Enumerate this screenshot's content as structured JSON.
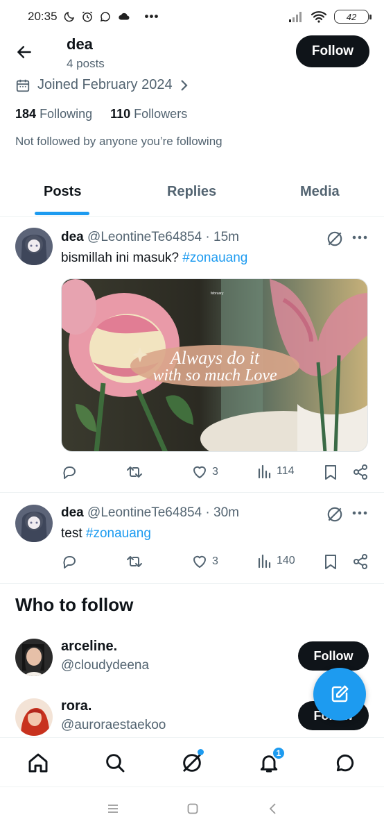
{
  "status_bar": {
    "time": "20:35",
    "battery": "42"
  },
  "header": {
    "name": "dea",
    "posts_count": "4 posts",
    "follow_label": "Follow"
  },
  "profile": {
    "joined": "Joined February 2024",
    "following_count": "184",
    "following_label": "Following",
    "followers_count": "110",
    "followers_label": "Followers",
    "not_followed_note": "Not followed by anyone you’re following"
  },
  "tabs": [
    {
      "label": "Posts",
      "active": true
    },
    {
      "label": "Replies",
      "active": false
    },
    {
      "label": "Media",
      "active": false
    }
  ],
  "posts": [
    {
      "name": "dea",
      "handle": "@LeontineTe64854",
      "sep": " · ",
      "time": "15m",
      "text": "bismillah ini masuk? ",
      "hashtag": "#zonauang",
      "image_caption_line1": "Always do it",
      "image_caption_line2": "with so much Love",
      "image_small_text": "february",
      "likes": "3",
      "views": "114"
    },
    {
      "name": "dea",
      "handle": "@LeontineTe64854",
      "sep": " · ",
      "time": "30m",
      "text": "test ",
      "hashtag": "#zonauang",
      "likes": "3",
      "views": "140"
    }
  ],
  "who_to_follow": {
    "title": "Who to follow",
    "suggestions": [
      {
        "name": "arceline.",
        "handle": "@cloudydeena",
        "button": "Follow"
      },
      {
        "name": "rora.",
        "handle": "@auroraestaekoo",
        "button": "Follow"
      }
    ]
  },
  "bottom_nav": {
    "notifications_badge": "1"
  },
  "colors": {
    "accent": "#1d9bf0",
    "text": "#0f1419",
    "muted": "#536471"
  }
}
